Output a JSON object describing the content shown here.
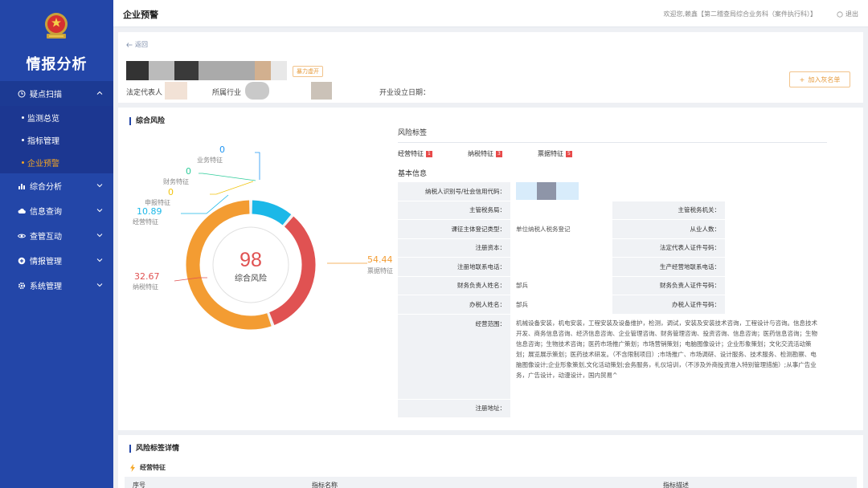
{
  "sidebar": {
    "brand": "情报分析",
    "menu": [
      {
        "label": "疑点扫描",
        "icon": "clock-icon",
        "open": true,
        "children": [
          {
            "label": "监测总览"
          },
          {
            "label": "指标管理"
          },
          {
            "label": "企业预警"
          }
        ]
      },
      {
        "label": "综合分析",
        "icon": "bar-chart-icon"
      },
      {
        "label": "信息查询",
        "icon": "cloud-icon"
      },
      {
        "label": "查管互动",
        "icon": "eye-icon"
      },
      {
        "label": "情报管理",
        "icon": "plus-circle-icon"
      },
      {
        "label": "系统管理",
        "icon": "gear-icon"
      }
    ]
  },
  "topbar": {
    "title": "企业预警",
    "welcome": "欢迎您,赖鑫【第二稽查局综合业务科（案件执行科）】",
    "logout": "退出"
  },
  "company": {
    "back": "返回",
    "badge": "暴力虚开",
    "legal_rep_label": "法定代表人",
    "industry_label": "所属行业",
    "setup_date_label": "开业设立日期：",
    "blacklist_button": "加入灰名单"
  },
  "overall_risk": {
    "title": "综合风险",
    "score": "98",
    "score_label": "综合风险",
    "segments": [
      {
        "name": "业务特征",
        "value": 0,
        "color": "#2196f3"
      },
      {
        "name": "财务特征",
        "value": 0,
        "color": "#2ecc9a"
      },
      {
        "name": "申报特征",
        "value": 0,
        "color": "#f1c40f"
      },
      {
        "name": "经营特征",
        "value": 10.89,
        "color": "#1bb8e8"
      },
      {
        "name": "纳税特征",
        "value": 32.67,
        "color": "#e05252"
      },
      {
        "name": "票据特征",
        "value": 54.44,
        "color": "#f39c32"
      }
    ],
    "labels": {
      "ywtz_v": "0",
      "ywtz_n": "业务特征",
      "cwtz_v": "0",
      "cwtz_n": "财务特征",
      "sbtz_v": "0",
      "sbtz_n": "申报特征",
      "jytz_v": "10.89",
      "jytz_n": "经营特征",
      "nstz_v": "32.67",
      "nstz_n": "纳税特征",
      "pjtz_v": "54.44",
      "pjtz_n": "票据特征"
    }
  },
  "risk_tags": {
    "title": "风险标签",
    "tags": [
      {
        "label": "经营特征",
        "count": "1"
      },
      {
        "label": "纳税特征",
        "count": "3"
      },
      {
        "label": "票据特征",
        "count": "5"
      }
    ]
  },
  "basic_info": {
    "title": "基本信息",
    "taxpayer_id": "纳税人识别号/社会信用代码：",
    "tax_bureau": "主管税务局：",
    "tax_authority": "主管税务机关：",
    "reg_type": "课征主体登记类型：",
    "reg_type_value": "单位纳税人税务登记",
    "employees": "从业人数：",
    "capital": "注册资本：",
    "legal_id": "法定代表人证件号码：",
    "reg_phone": "注册地联系电话：",
    "biz_phone": "生产经营地联系电话：",
    "finance_name": "财务负责人姓名：",
    "finance_name_value": "郜兵",
    "finance_id": "财务负责人证件号码：",
    "agent_name": "办税人姓名：",
    "agent_name_value": "郜兵",
    "agent_id": "办税人证件号码：",
    "scope": "经营范围：",
    "scope_value": "机械设备安装，机电安装，工程安装及设备维护，检测，调试，安装及安装技术咨询，工程设计与咨询。信息技术开发、商务信息咨询、经济信息咨询、企业管理咨询、财务管理咨询、投资咨询、信息咨询；医药信息咨询；生物信息咨询；生物技术咨询；医药市场推广策划；市场营销策划；电脑图像设计；企业形象策划；文化交流活动策划；展览展示策划；医药技术研发。（不含限制项目）;市场推广、市场调研、设计服务、技术服务、检测勘察、电脑图像设计;企业形象策划,文化活动策划;会务服务，礼仪培训，（不涉及外商投资准入特别管理措施）;从事广告业务，广告设计，动漫设计，国内贸易^",
    "address": "注册地址："
  },
  "risk_detail": {
    "title": "风险标签详情",
    "sub": "经营特征",
    "col_no": "序号",
    "col_name": "指标名称",
    "col_desc": "指标描述"
  }
}
